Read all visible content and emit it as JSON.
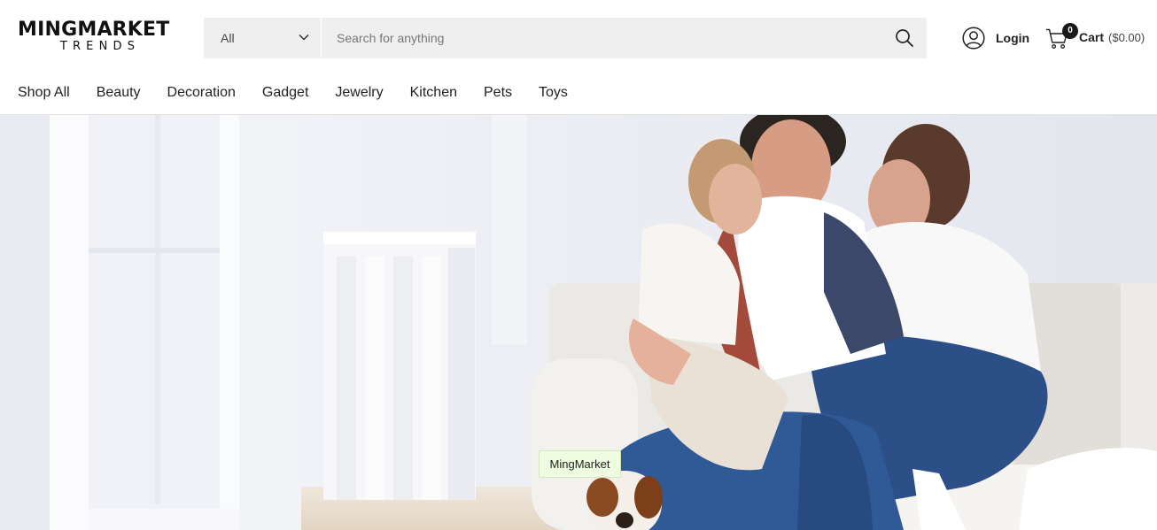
{
  "brand": {
    "name": "MINGMARKET",
    "tagline": "TRENDS"
  },
  "search": {
    "category_selected": "All",
    "placeholder": "Search for anything",
    "value": ""
  },
  "account": {
    "login_label": "Login"
  },
  "cart": {
    "count": "0",
    "label": "Cart",
    "total": "($0.00)"
  },
  "nav": {
    "items": [
      {
        "label": "Shop All"
      },
      {
        "label": "Beauty"
      },
      {
        "label": "Decoration"
      },
      {
        "label": "Gadget"
      },
      {
        "label": "Jewelry"
      },
      {
        "label": "Kitchen"
      },
      {
        "label": "Pets"
      },
      {
        "label": "Toys"
      }
    ]
  },
  "hero": {
    "tooltip": "MingMarket",
    "image": "hero-family-sofa-image"
  },
  "icons": {
    "dropdown": "chevron-down-icon",
    "search": "search-icon",
    "user": "user-icon",
    "cart": "cart-icon"
  },
  "colors": {
    "search_background": "#efefef",
    "badge": "#1a1a1a",
    "tooltip_background": "#eefddf"
  }
}
